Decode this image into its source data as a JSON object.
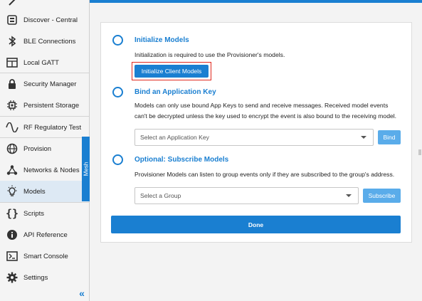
{
  "sidebar": {
    "items": [
      {
        "label": "Discover - Central",
        "icon": "discover-icon"
      },
      {
        "label": "BLE Connections",
        "icon": "bluetooth-icon"
      },
      {
        "label": "Local GATT",
        "icon": "table-icon"
      },
      {
        "label": "Security Manager",
        "icon": "lock-icon"
      },
      {
        "label": "Persistent Storage",
        "icon": "chip-icon"
      },
      {
        "label": "RF Regulatory Test",
        "icon": "wave-icon"
      },
      {
        "label": "Provision",
        "icon": "globe-icon"
      },
      {
        "label": "Networks & Nodes",
        "icon": "network-icon"
      },
      {
        "label": "Models",
        "icon": "lightbulb-icon"
      },
      {
        "label": "Scripts",
        "icon": "braces-icon"
      },
      {
        "label": "API Reference",
        "icon": "info-icon"
      },
      {
        "label": "Smart Console",
        "icon": "console-icon"
      },
      {
        "label": "Settings",
        "icon": "gear-icon"
      }
    ],
    "mesh_label": "Mesh",
    "collapse_icon": "«"
  },
  "steps": {
    "init": {
      "title": "Initialize Models",
      "description": "Initialization is required to use the Provisioner's models.",
      "button": "Initialize Client Models"
    },
    "bind": {
      "title": "Bind an Application Key",
      "description_line1": "Models can only use bound App Keys to send and receive messages. Received model events",
      "description_line2": "can't be decrypted unless the key used to encrypt the event is also bound to the receiving model.",
      "select_placeholder": "Select an Application Key",
      "button": "Bind"
    },
    "subscribe": {
      "title": "Optional: Subscribe Models",
      "description": "Provisioner Models can listen to group events only if they are subscribed to the group's address.",
      "select_placeholder": "Select a Group",
      "button": "Subscribe"
    }
  },
  "done_button": "Done",
  "colors": {
    "accent": "#1a7fd1",
    "highlight": "#e0281e",
    "selected_bg": "#dde9f4"
  }
}
